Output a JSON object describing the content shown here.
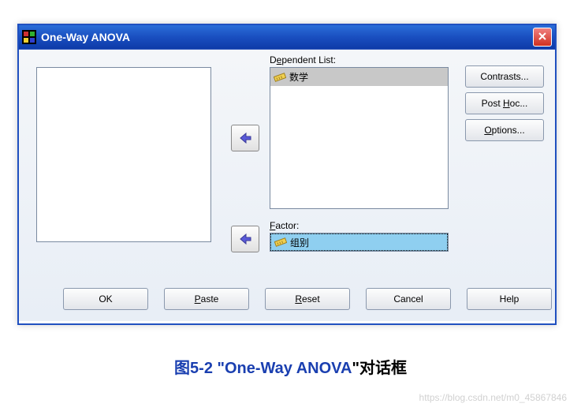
{
  "window": {
    "title": "One-Way ANOVA"
  },
  "labels": {
    "dependent": "Dependent List:",
    "factor": "Factor:"
  },
  "dependent_list": {
    "items": [
      "数学"
    ]
  },
  "factor": {
    "value": "组别"
  },
  "side_buttons": {
    "contrasts": "Contrasts...",
    "post_hoc_pre": "Post ",
    "post_hoc_ul": "H",
    "post_hoc_post": "oc...",
    "options_ul": "O",
    "options_post": "ptions..."
  },
  "bottom_buttons": {
    "ok": "OK",
    "paste_ul": "P",
    "paste_post": "aste",
    "reset_ul": "R",
    "reset_post": "eset",
    "cancel": "Cancel",
    "help": "Help"
  },
  "caption": {
    "fig_pre": "图5-2  \"",
    "fig_mid": "One-Way ANOVA",
    "fig_post": "\"对话框"
  },
  "watermark": "https://blog.csdn.net/m0_45867846"
}
